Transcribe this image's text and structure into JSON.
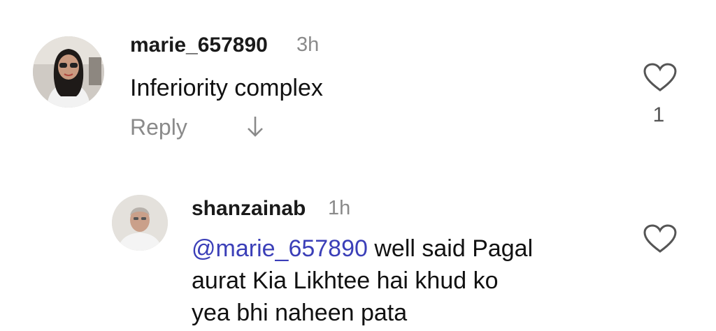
{
  "comments": [
    {
      "username": "marie_657890",
      "time": "3h",
      "text": "Inferiority complex",
      "reply_label": "Reply",
      "like_count": "1",
      "icons": {
        "like": "heart-icon",
        "expand": "arrow-down-icon"
      }
    },
    {
      "username": "shanzainab",
      "time": "1h",
      "mention": "@marie_657890",
      "text_line1": " well said Pagal",
      "text_line2": "aurat Kia Likhtee hai khud ko",
      "text_line3": "yea bhi naheen pata",
      "icons": {
        "like": "heart-icon"
      }
    }
  ],
  "colors": {
    "mention": "#3b3fb8",
    "secondary": "#8a8a8a"
  }
}
